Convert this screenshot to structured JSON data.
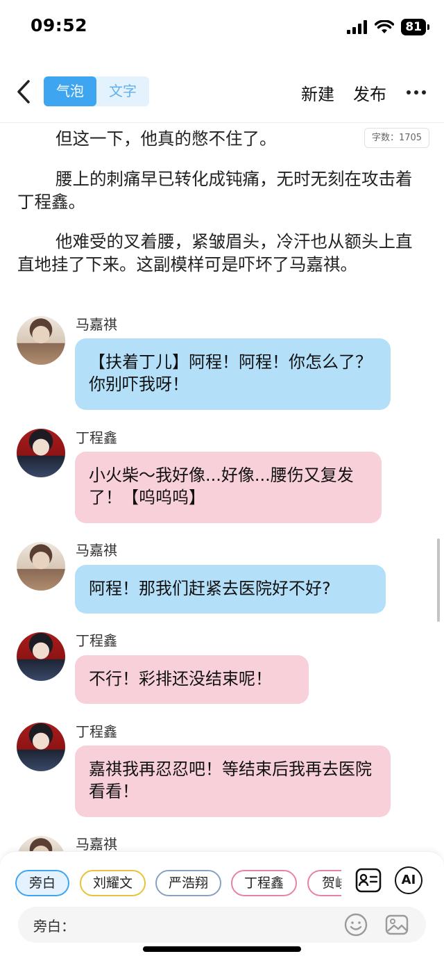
{
  "status": {
    "time": "09:52",
    "battery": "81"
  },
  "nav": {
    "back_icon": "chevron-left-icon",
    "tab_bubble": "气泡",
    "tab_text": "文字",
    "new_label": "新建",
    "publish_label": "发布",
    "more_icon": "more-dots-icon"
  },
  "word_count": "字数：1705",
  "narration": [
    "但这一下，他真的憋不住了。",
    "腰上的刺痛早已转化成钝痛，无时无刻在攻击着丁程鑫。",
    "他难受的叉着腰，紧皱眉头，冷汗也从额头上直直地挂了下来。这副模样可是吓坏了马嘉祺。"
  ],
  "messages": [
    {
      "speaker": "马嘉祺",
      "text": "【扶着丁儿】阿程！阿程！你怎么了？你别吓我呀！",
      "color": "#b3dff9"
    },
    {
      "speaker": "丁程鑫",
      "text": "小火柴～我好像...好像...腰伤又复发了！【呜呜呜】",
      "color": "#f7d0da"
    },
    {
      "speaker": "马嘉祺",
      "text": "阿程！那我们赶紧去医院好不好?",
      "color": "#b3dff9"
    },
    {
      "speaker": "丁程鑫",
      "text": "不行！彩排还没结束呢！",
      "color": "#f7d0da"
    },
    {
      "speaker": "丁程鑫",
      "text": "嘉祺我再忍忍吧！等结束后我再去医院看看！",
      "color": "#f7d0da"
    },
    {
      "speaker": "马嘉祺",
      "text": "",
      "color": "#b3dff9"
    }
  ],
  "roles": [
    {
      "label": "旁白",
      "color": "#3ea5f0",
      "selected": true
    },
    {
      "label": "刘耀文",
      "color": "#e8c23a",
      "selected": false
    },
    {
      "label": "严浩翔",
      "color": "#8aa0c0",
      "selected": false
    },
    {
      "label": "丁程鑫",
      "color": "#e882a0",
      "selected": false
    },
    {
      "label": "贺峻",
      "color": "#e882a0",
      "selected": false
    }
  ],
  "tools": {
    "card_icon": "contact-card-icon",
    "ai_label": "AI"
  },
  "input": {
    "label": "旁白：",
    "emoji_icon": "smiley-icon",
    "image_icon": "image-icon"
  }
}
